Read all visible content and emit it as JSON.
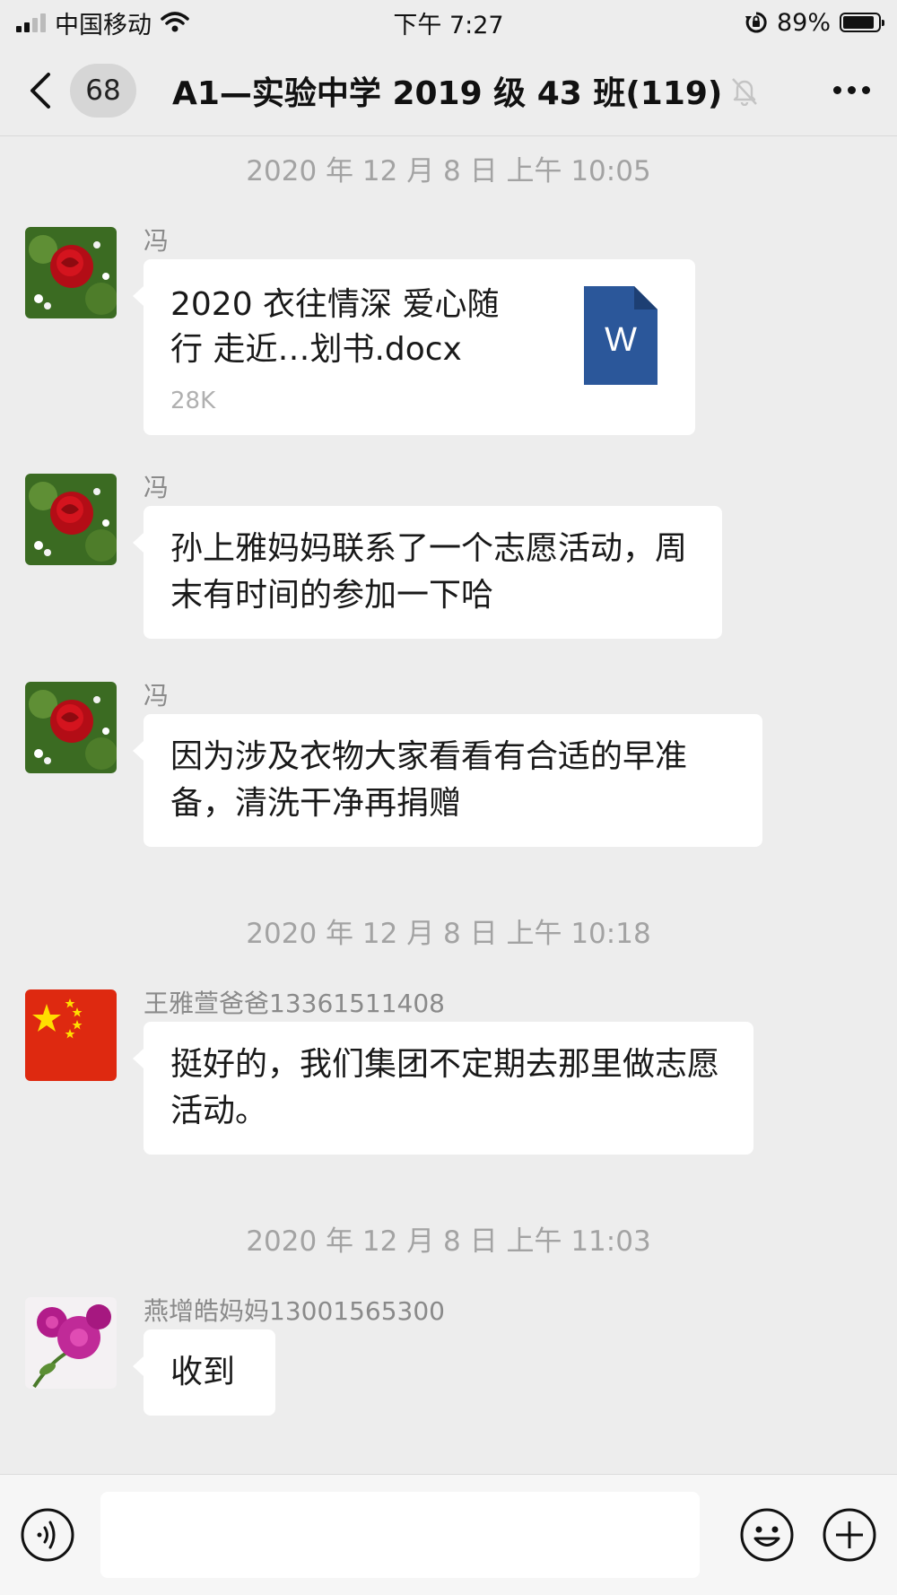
{
  "status_bar": {
    "carrier": "中国移动",
    "time": "下午 7:27",
    "battery": "89%",
    "battery_level": 0.89,
    "icons": [
      "signal-icon",
      "wifi-icon",
      "orientation-lock-icon",
      "battery-icon"
    ]
  },
  "nav": {
    "unread_count": "68",
    "title": "A1—实验中学 2019 级 43 班(119)",
    "icons": [
      "back-chevron-icon",
      "mute-bell-icon",
      "more-dots-icon"
    ]
  },
  "timestamps": [
    "2020 年 12 月 8 日 上午 10:05",
    "2020 年 12 月 8 日 上午 10:18",
    "2020 年 12 月 8 日 上午 11:03"
  ],
  "messages": [
    {
      "sender": "冯",
      "type": "file",
      "file_name": "2020  衣往情深 爱心随行 走近…划书.docx",
      "file_size": "28K",
      "file_icon": "word-doc-icon",
      "file_icon_letter": "W"
    },
    {
      "sender": "冯",
      "type": "text",
      "text": "孙上雅妈妈联系了一个志愿活动，周末有时间的参加一下哈"
    },
    {
      "sender": "冯",
      "type": "text",
      "text": "因为涉及衣物大家看看有合适的早准备，清洗干净再捐赠"
    },
    {
      "sender": "王雅萱爸爸13361511408",
      "type": "text",
      "text": "挺好的，我们集团不定期去那里做志愿活动。"
    },
    {
      "sender": "燕增皓妈妈13001565300",
      "type": "text",
      "text": "收到"
    }
  ],
  "input_bar": {
    "icons": [
      "voice-icon",
      "emoji-icon",
      "plus-icon"
    ]
  },
  "colors": {
    "background": "#ededed",
    "bubble": "#ffffff",
    "word_blue": "#2b579a",
    "flag_red": "#de2910",
    "flag_star": "#ffde00"
  }
}
